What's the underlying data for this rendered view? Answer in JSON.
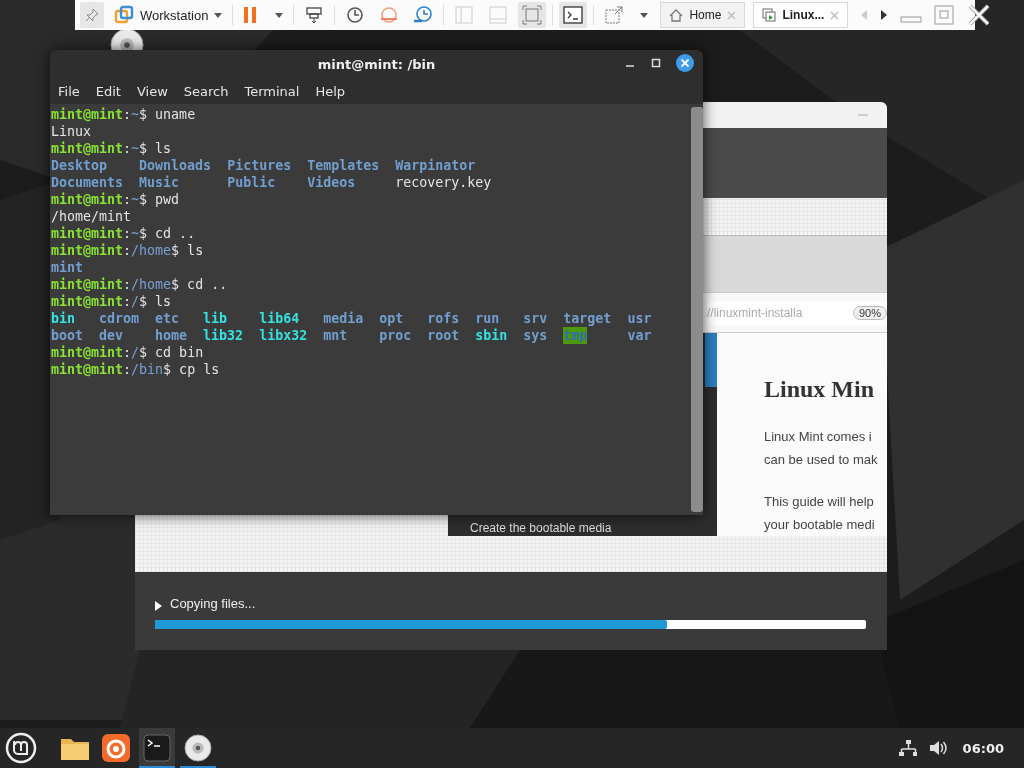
{
  "desktop_icons": [
    {
      "kind": "disc"
    }
  ],
  "vm_toolbar": {
    "product": "Workstation",
    "tabs": [
      {
        "label": "Home",
        "kind": "home",
        "selected": false
      },
      {
        "label": "Linux...",
        "kind": "vm",
        "selected": true
      }
    ]
  },
  "installer": {
    "url": "//linuxmint-installa",
    "zoom": "90%",
    "heading": "Linux Min",
    "paragraphs": [
      [
        "Linux Mint comes i",
        "can be used to mak"
      ],
      [
        "This guide will help",
        "your bootable medi"
      ]
    ],
    "caption": "Create the bootable media",
    "status": "Copying files...",
    "progress": {
      "level": 0.72
    }
  },
  "terminal": {
    "title": "mint@mint: /bin",
    "menu": [
      "File",
      "Edit",
      "View",
      "Search",
      "Terminal",
      "Help"
    ],
    "lines": [
      {
        "kind": "command",
        "parts": [
          {
            "text": "mint@mint",
            "kind": "user"
          },
          {
            "text": ":",
            "kind": "plain"
          },
          {
            "text": "~",
            "kind": "path"
          },
          {
            "text": "$ uname",
            "kind": "plain"
          }
        ]
      },
      {
        "kind": "output",
        "parts": [
          {
            "text": "Linux",
            "kind": "plain"
          }
        ]
      },
      {
        "kind": "command",
        "parts": [
          {
            "text": "mint@mint",
            "kind": "user"
          },
          {
            "text": ":",
            "kind": "plain"
          },
          {
            "text": "~",
            "kind": "path"
          },
          {
            "text": "$ ls",
            "kind": "plain"
          }
        ]
      },
      {
        "kind": "listing",
        "rows": [
          [
            {
              "text": "Desktop",
              "kind": "dir"
            },
            {
              "text": "Downloads",
              "kind": "dir"
            },
            {
              "text": "Pictures",
              "kind": "dir"
            },
            {
              "text": "Templates",
              "kind": "dir"
            },
            {
              "text": "Warpinator",
              "kind": "dir"
            }
          ],
          [
            {
              "text": "Documents",
              "kind": "dir"
            },
            {
              "text": "Music",
              "kind": "dir"
            },
            {
              "text": "Public",
              "kind": "dir"
            },
            {
              "text": "Videos",
              "kind": "dir"
            },
            {
              "text": "recovery.key",
              "kind": "plain"
            }
          ]
        ]
      },
      {
        "kind": "command",
        "parts": [
          {
            "text": "mint@mint",
            "kind": "user"
          },
          {
            "text": ":",
            "kind": "plain"
          },
          {
            "text": "~",
            "kind": "path"
          },
          {
            "text": "$ pwd",
            "kind": "plain"
          }
        ]
      },
      {
        "kind": "output",
        "parts": [
          {
            "text": "/home/mint",
            "kind": "plain"
          }
        ]
      },
      {
        "kind": "command",
        "parts": [
          {
            "text": "mint@mint",
            "kind": "user"
          },
          {
            "text": ":",
            "kind": "plain"
          },
          {
            "text": "~",
            "kind": "path"
          },
          {
            "text": "$ cd ..",
            "kind": "plain"
          }
        ]
      },
      {
        "kind": "command",
        "parts": [
          {
            "text": "mint@mint",
            "kind": "user"
          },
          {
            "text": ":",
            "kind": "plain"
          },
          {
            "text": "/home",
            "kind": "path"
          },
          {
            "text": "$ ls",
            "kind": "plain"
          }
        ]
      },
      {
        "kind": "output",
        "parts": [
          {
            "text": "mint",
            "kind": "dir"
          }
        ]
      },
      {
        "kind": "command",
        "parts": [
          {
            "text": "mint@mint",
            "kind": "user"
          },
          {
            "text": ":",
            "kind": "plain"
          },
          {
            "text": "/home",
            "kind": "path"
          },
          {
            "text": "$ cd ..",
            "kind": "plain"
          }
        ]
      },
      {
        "kind": "command",
        "parts": [
          {
            "text": "mint@mint",
            "kind": "user"
          },
          {
            "text": ":",
            "kind": "plain"
          },
          {
            "text": "/",
            "kind": "path"
          },
          {
            "text": "$ ls",
            "kind": "plain"
          }
        ]
      },
      {
        "kind": "listing",
        "rows": [
          [
            {
              "text": "bin",
              "kind": "link"
            },
            {
              "text": "cdrom",
              "kind": "dir"
            },
            {
              "text": "etc",
              "kind": "dir"
            },
            {
              "text": "lib",
              "kind": "link"
            },
            {
              "text": "lib64",
              "kind": "link"
            },
            {
              "text": "media",
              "kind": "dir"
            },
            {
              "text": "opt",
              "kind": "dir"
            },
            {
              "text": "rofs",
              "kind": "dir"
            },
            {
              "text": "run",
              "kind": "dir"
            },
            {
              "text": "srv",
              "kind": "dir"
            },
            {
              "text": "target",
              "kind": "dir"
            },
            {
              "text": "usr",
              "kind": "dir"
            }
          ],
          [
            {
              "text": "boot",
              "kind": "dir"
            },
            {
              "text": "dev",
              "kind": "dir"
            },
            {
              "text": "home",
              "kind": "dir"
            },
            {
              "text": "lib32",
              "kind": "link"
            },
            {
              "text": "libx32",
              "kind": "link"
            },
            {
              "text": "mnt",
              "kind": "dir"
            },
            {
              "text": "proc",
              "kind": "dir"
            },
            {
              "text": "root",
              "kind": "dir"
            },
            {
              "text": "sbin",
              "kind": "link"
            },
            {
              "text": "sys",
              "kind": "dir"
            },
            {
              "text": "tmp",
              "kind": "sticky"
            },
            {
              "text": "var",
              "kind": "dir"
            }
          ]
        ]
      },
      {
        "kind": "command",
        "parts": [
          {
            "text": "mint@mint",
            "kind": "user"
          },
          {
            "text": ":",
            "kind": "plain"
          },
          {
            "text": "/",
            "kind": "path"
          },
          {
            "text": "$ cd bin",
            "kind": "plain"
          }
        ]
      },
      {
        "kind": "command",
        "parts": [
          {
            "text": "mint@mint",
            "kind": "user"
          },
          {
            "text": ":",
            "kind": "plain"
          },
          {
            "text": "/bin",
            "kind": "path"
          },
          {
            "text": "$ cp ls",
            "kind": "plain"
          }
        ]
      }
    ]
  },
  "taskbar": {
    "apps": [
      {
        "kind": "folder",
        "active": false,
        "running": false
      },
      {
        "kind": "browser",
        "active": false,
        "running": false
      },
      {
        "kind": "terminal",
        "active": true,
        "running": true
      },
      {
        "kind": "disc",
        "active": false,
        "running": true
      }
    ],
    "clock": "06:00"
  }
}
